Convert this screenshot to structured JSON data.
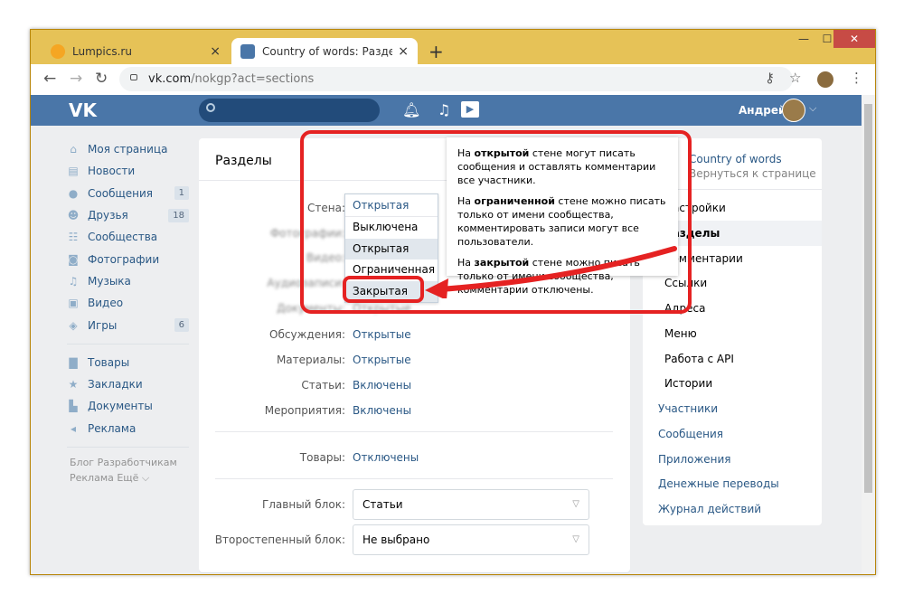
{
  "browser": {
    "tabs": [
      {
        "title": "Lumpics.ru",
        "favicon_color": "#f5a623"
      },
      {
        "title": "Country of words: Разделы",
        "favicon_color": "#4a76a8"
      }
    ],
    "url_host": "vk.com",
    "url_path": "/nokgp?act=sections",
    "new_tab": "+",
    "close": "×"
  },
  "vk_header": {
    "logo": "VK",
    "user_name": "Андрей"
  },
  "side_menu": {
    "items": [
      {
        "label": "Моя страница",
        "icon": "home-icon",
        "glyph": "⌂"
      },
      {
        "label": "Новости",
        "icon": "news-icon",
        "glyph": "▤"
      },
      {
        "label": "Сообщения",
        "icon": "messages-icon",
        "glyph": "●",
        "badge": "1"
      },
      {
        "label": "Друзья",
        "icon": "friends-icon",
        "glyph": "☻",
        "badge": "18"
      },
      {
        "label": "Сообщества",
        "icon": "groups-icon",
        "glyph": "☷"
      },
      {
        "label": "Фотографии",
        "icon": "camera-icon",
        "glyph": "◙"
      },
      {
        "label": "Музыка",
        "icon": "music-icon",
        "glyph": "♫"
      },
      {
        "label": "Видео",
        "icon": "video-icon",
        "glyph": "▣"
      },
      {
        "label": "Игры",
        "icon": "games-icon",
        "glyph": "◈",
        "badge": "6"
      }
    ],
    "items2": [
      {
        "label": "Товары",
        "icon": "bag-icon",
        "glyph": "▇"
      },
      {
        "label": "Закладки",
        "icon": "star-icon",
        "glyph": "★"
      },
      {
        "label": "Документы",
        "icon": "document-icon",
        "glyph": "▙"
      },
      {
        "label": "Реклама",
        "icon": "ads-icon",
        "glyph": "◂"
      }
    ],
    "footer_line1": "Блог   Разработчикам",
    "footer_line2": "Реклама   Ещё ⌵"
  },
  "main": {
    "title": "Разделы",
    "wall_label": "Стена:",
    "wall_value": "Открытая",
    "blurred_labels": [
      "Фотографии:",
      "Видео:",
      "Аудиозаписи:",
      "Документы:"
    ],
    "blurred_value": "Открытые",
    "rows": [
      {
        "label": "Обсуждения:",
        "value": "Открытые"
      },
      {
        "label": "Материалы:",
        "value": "Открытые"
      },
      {
        "label": "Статьи:",
        "value": "Включены"
      },
      {
        "label": "Мероприятия:",
        "value": "Включены"
      }
    ],
    "goods_label": "Товары:",
    "goods_value": "Отключены",
    "main_block_label": "Главный блок:",
    "main_block_value": "Статьи",
    "secondary_block_label": "Второстепенный блок:",
    "secondary_block_value": "Не выбрано"
  },
  "dropdown": {
    "current": "Открытая",
    "options": [
      "Выключена",
      "Открытая",
      "Ограниченная",
      "Закрытая"
    ],
    "selected_index": 1
  },
  "tooltip": {
    "p1_a": "На ",
    "p1_b": "открытой",
    "p1_c": " стене могут писать сообщения и оставлять комментарии все участники.",
    "p2_a": "На ",
    "p2_b": "ограниченной",
    "p2_c": " стене можно писать только от имени сообщества, комментировать записи могут все пользователи.",
    "p3_a": "На ",
    "p3_b": "закрытой",
    "p3_c": " стене можно писать только от имени сообщества, комментарии отключены."
  },
  "right_menu": {
    "group_name": "Country of words",
    "back_link": "Вернуться к странице",
    "items": [
      {
        "label": "Настройки",
        "kind": "item"
      },
      {
        "label": "Разделы",
        "kind": "active"
      },
      {
        "label": "Комментарии",
        "kind": "item"
      },
      {
        "label": "Ссылки",
        "kind": "sub"
      },
      {
        "label": "Адреса",
        "kind": "sub"
      },
      {
        "label": "Меню",
        "kind": "sub"
      },
      {
        "label": "Работа с API",
        "kind": "sub"
      },
      {
        "label": "Истории",
        "kind": "sub"
      },
      {
        "label": "Участники",
        "kind": "link"
      },
      {
        "label": "Сообщения",
        "kind": "link"
      },
      {
        "label": "Приложения",
        "kind": "link"
      },
      {
        "label": "Денежные переводы",
        "kind": "link"
      },
      {
        "label": "Журнал действий",
        "kind": "link"
      }
    ]
  },
  "annotation_color": "#e52222"
}
